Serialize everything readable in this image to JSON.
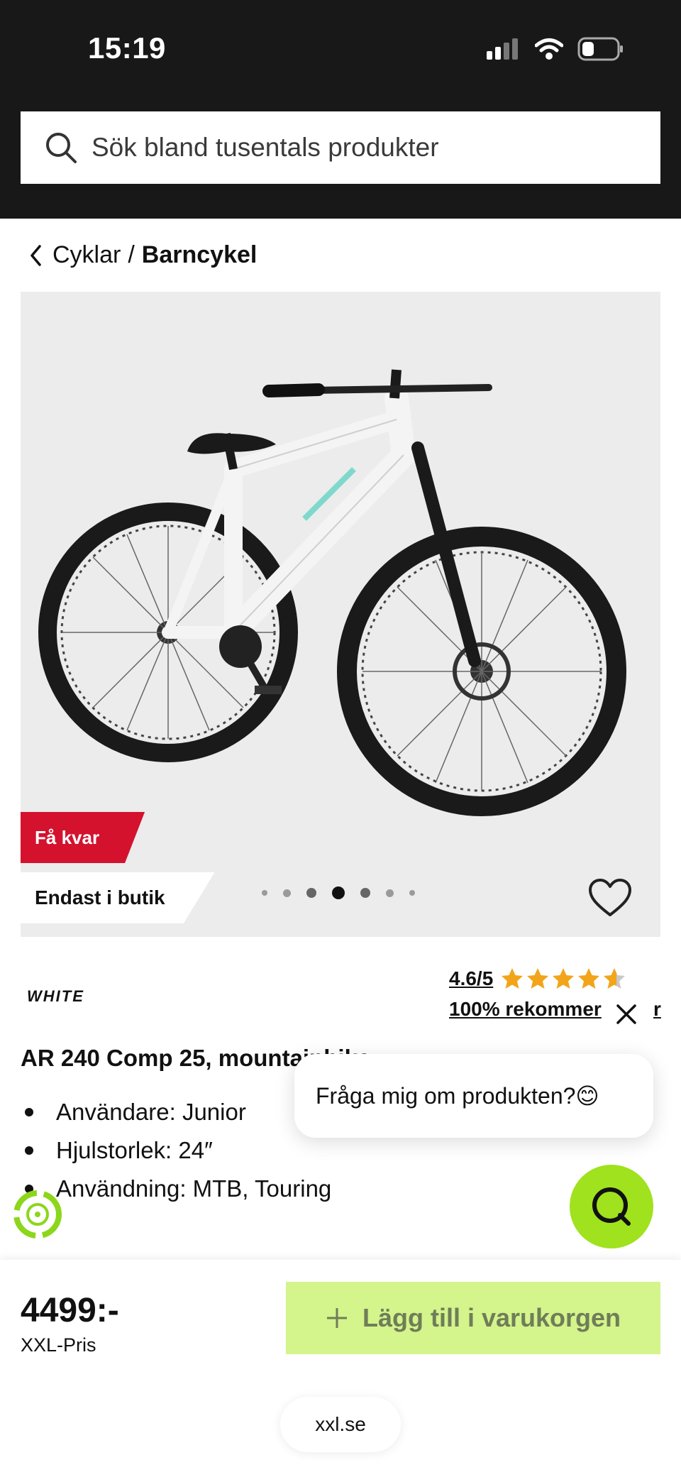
{
  "status_bar": {
    "time": "15:19"
  },
  "search": {
    "placeholder": "Sök bland tusentals produkter"
  },
  "breadcrumb": {
    "parent": "Cyklar",
    "separator": "/",
    "current": "Barncykel"
  },
  "hero": {
    "badge_few_left": "Få kvar",
    "badge_store_only": "Endast i butik",
    "carousel_total": 7,
    "carousel_active_index": 3
  },
  "product": {
    "brand": "WHITE",
    "rating": "4.6/5",
    "rating_value": 4.6,
    "recommend": "100% rekommer",
    "recommend_tail": "r",
    "title": "AR 240 Comp 25, mountainbike",
    "bullets": [
      "Användare: Junior",
      "Hjulstorlek: 24″",
      "Användning: MTB, Touring"
    ]
  },
  "chat": {
    "prompt": "Fråga mig om produkten?😊"
  },
  "bottom_bar": {
    "price": "4499:-",
    "price_label": "XXL-Pris",
    "add_to_cart": "Lägg till i varukorgen",
    "url": "xxl.se"
  },
  "colors": {
    "header_bg": "#181818",
    "sale_red": "#d4122e",
    "chat_green": "#9fe21d",
    "cart_btn_bg": "#d4f48c",
    "star": "#f2a51a"
  }
}
